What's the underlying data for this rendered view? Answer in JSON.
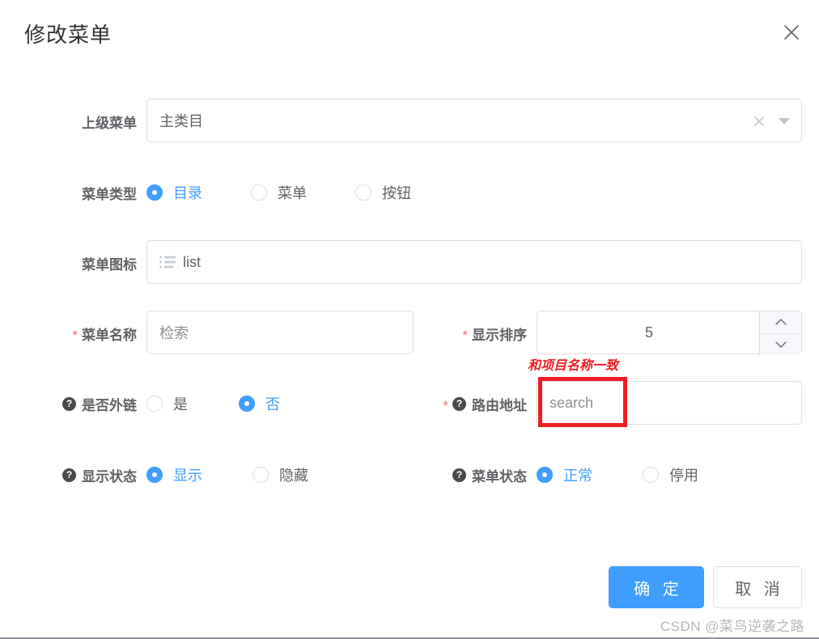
{
  "dialog": {
    "title": "修改菜单",
    "close_icon": "close-icon"
  },
  "form": {
    "parent_menu": {
      "label": "上级菜单",
      "value": "主类目",
      "clear_icon": "clear-icon",
      "caret_icon": "chevron-down-icon"
    },
    "menu_type": {
      "label": "菜单类型",
      "options": [
        {
          "label": "目录",
          "checked": true
        },
        {
          "label": "菜单",
          "checked": false
        },
        {
          "label": "按钮",
          "checked": false
        }
      ]
    },
    "menu_icon": {
      "label": "菜单图标",
      "value": "list",
      "icon": "list-icon"
    },
    "menu_name": {
      "label": "菜单名称",
      "required_marker": "*",
      "value": "检索"
    },
    "display_order": {
      "label": "显示排序",
      "required_marker": "*",
      "value": "5",
      "increase_icon": "chevron-up-icon",
      "decrease_icon": "chevron-down-icon"
    },
    "is_external": {
      "label": "是否外链",
      "help_icon": "question-mark-icon",
      "help_glyph": "?",
      "options": [
        {
          "label": "是",
          "checked": false
        },
        {
          "label": "否",
          "checked": true
        }
      ]
    },
    "route_path": {
      "label": "路由地址",
      "required_marker": "*",
      "help_icon": "question-mark-icon",
      "help_glyph": "?",
      "value": "search"
    },
    "visible_status": {
      "label": "显示状态",
      "help_icon": "question-mark-icon",
      "help_glyph": "?",
      "options": [
        {
          "label": "显示",
          "checked": true
        },
        {
          "label": "隐藏",
          "checked": false
        }
      ]
    },
    "menu_status": {
      "label": "菜单状态",
      "help_icon": "question-mark-icon",
      "help_glyph": "?",
      "options": [
        {
          "label": "正常",
          "checked": true
        },
        {
          "label": "停用",
          "checked": false
        }
      ]
    }
  },
  "annotations": {
    "note_text": "和项目名称一致",
    "highlight_color": "#ee1c25"
  },
  "footer": {
    "confirm_label": "确 定",
    "cancel_label": "取 消"
  },
  "watermark": "CSDN @菜鸟逆袭之路",
  "colors": {
    "primary": "#409eff",
    "required": "#f56c6c",
    "annotation": "#ee1c25",
    "border": "#dcdfe6"
  }
}
